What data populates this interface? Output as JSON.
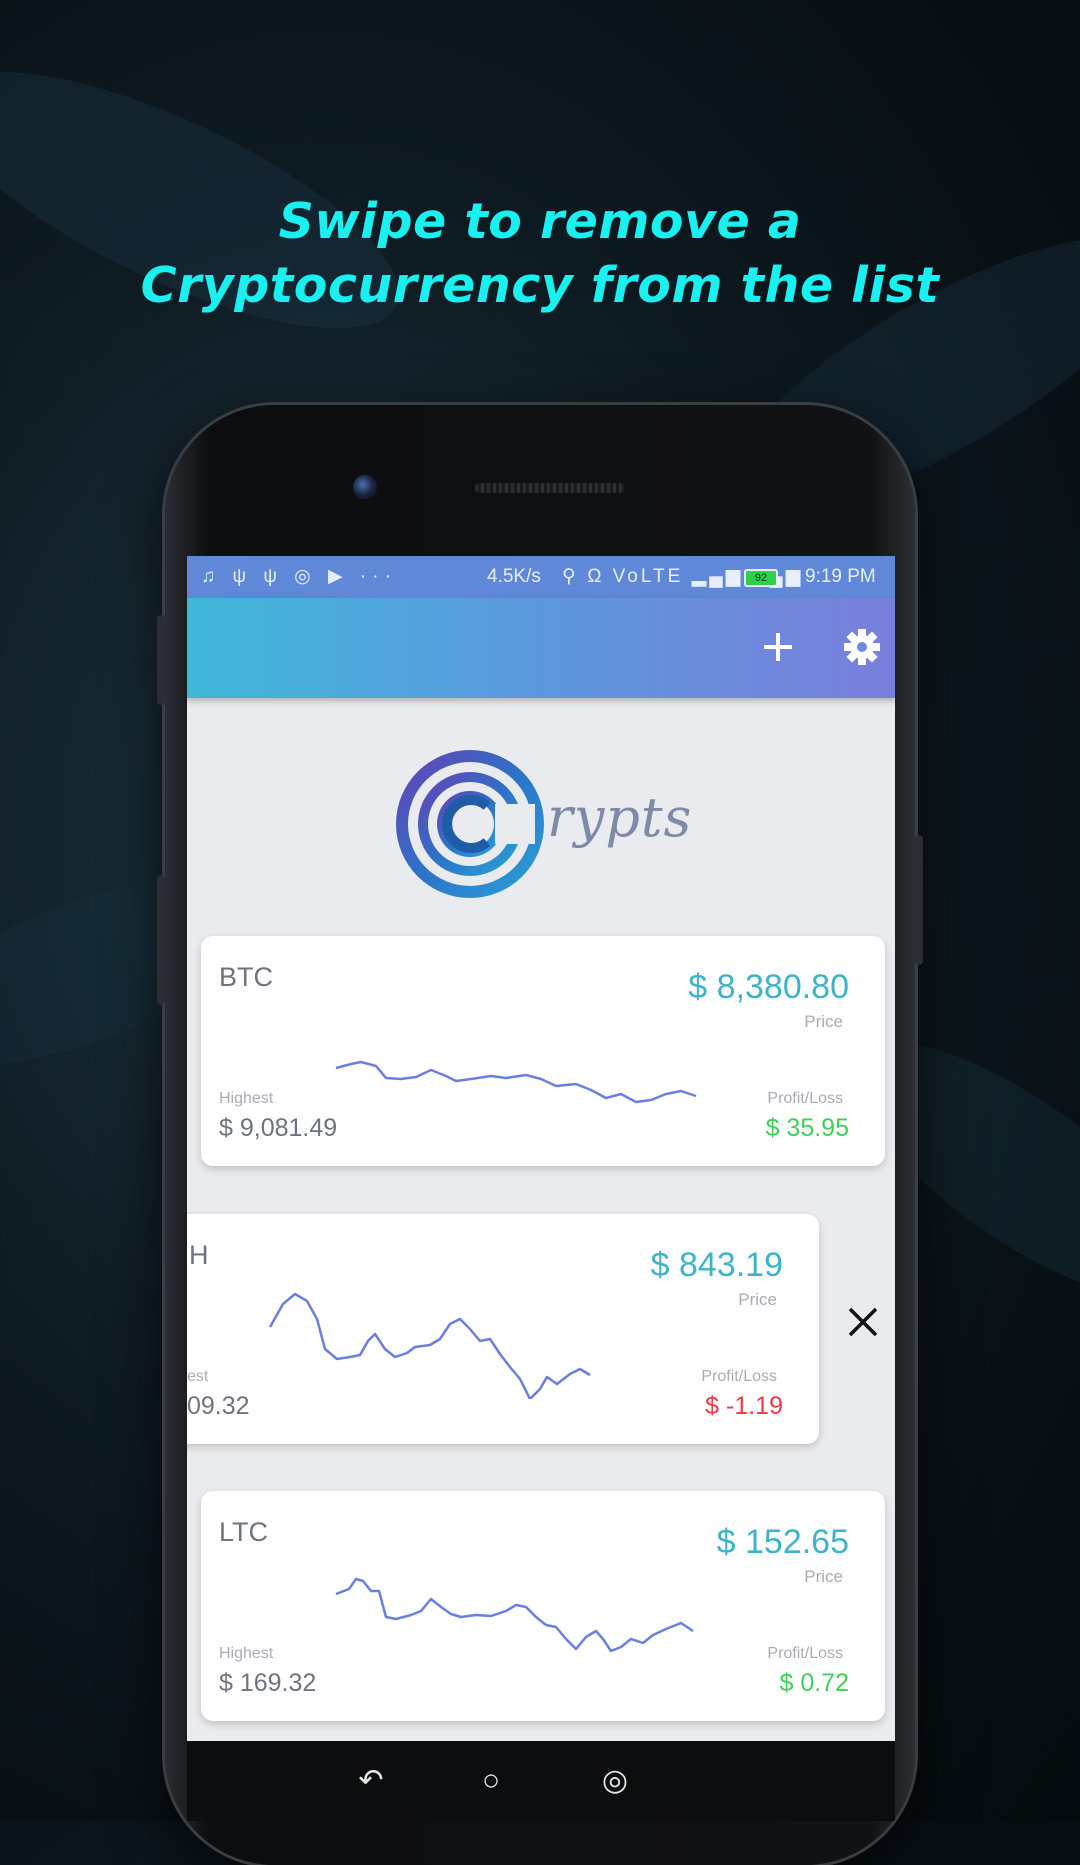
{
  "headline": {
    "line1": "Swipe to remove a",
    "line2": "Cryptocurrency from the list"
  },
  "statusbar": {
    "left_icons": "♫ ψ ψ ◎ ▶ ···",
    "speed": "4.5K/s",
    "mid_icons": "⚲ Ω VoLTE ▂▄▆ ▂▄▆",
    "battery": "92",
    "time": "9:19 PM"
  },
  "appbar": {
    "add_icon": "plus-icon",
    "settings_icon": "gear-icon"
  },
  "logo": {
    "text": "rypts"
  },
  "cards": [
    {
      "symbol": "BTC",
      "price": "$ 8,380.80",
      "price_label": "Price",
      "highest_label": "Highest",
      "highest": "$ 9,081.49",
      "pl_label": "Profit/Loss",
      "pl": "$ 35.95",
      "pl_color": "#3fd05a"
    },
    {
      "symbol": "H",
      "price": "$ 843.19",
      "price_label": "Price",
      "highest_label": "est",
      "highest": "09.32",
      "pl_label": "Profit/Loss",
      "pl": "$ -1.19",
      "pl_color": "#ee3a43"
    },
    {
      "symbol": "LTC",
      "price": "$ 152.65",
      "price_label": "Price",
      "highest_label": "Highest",
      "highest": "$ 169.32",
      "pl_label": "Profit/Loss",
      "pl": "$ 0.72",
      "pl_color": "#3fd05a"
    }
  ],
  "swipe_action": {
    "icon": "close-icon"
  },
  "navbar": {
    "back": "↶",
    "home": "○",
    "recents": "◎"
  },
  "colors": {
    "headline": "#19f0f0",
    "accent": "#3fb4c9",
    "sparkline": "#6b7fe0",
    "profit": "#3fd05a",
    "loss": "#ee3a43"
  }
}
